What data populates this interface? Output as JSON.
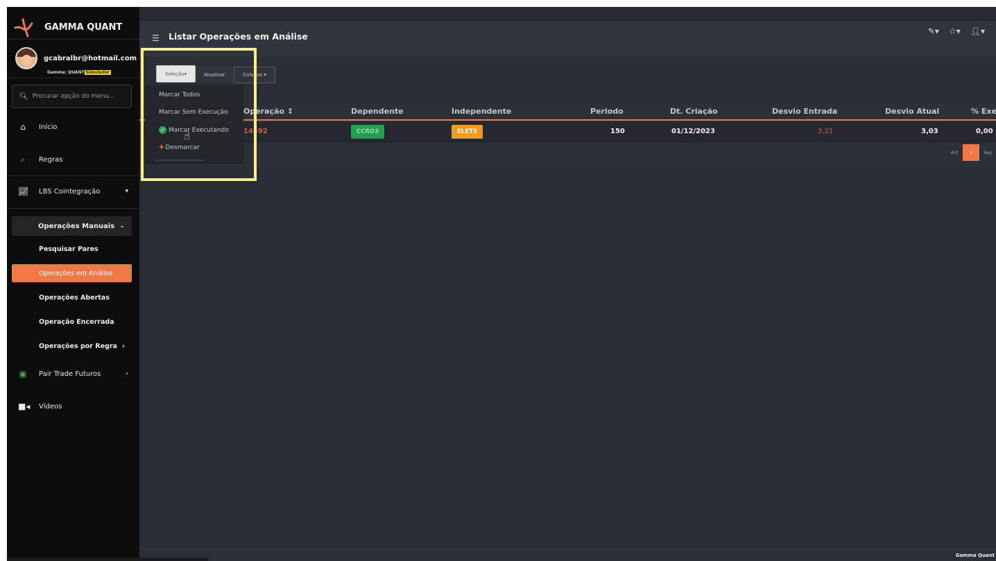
{
  "brand": {
    "name": "GAMMA QUANT"
  },
  "user": {
    "email": "gcabralbr@hotmail.com",
    "plan_prefix": "Gamma: QUANT",
    "plan_tag": "Simulador"
  },
  "search": {
    "placeholder": "Procurar opção do menu..."
  },
  "nav": {
    "inicio": "Início",
    "regras": "Regras",
    "lbs": "LBS Cointegração",
    "operacoes_manuais": "Operações Manuais",
    "subs": [
      "Pesquisar Pares",
      "Operações em Análise",
      "Operações Abertas",
      "Operação Encerrada",
      "Operações por Regra"
    ],
    "pair_trade": "Pair Trade Futuros",
    "videos": "Vídeos"
  },
  "header": {
    "title": "Listar Operações em Análise"
  },
  "toolbar": {
    "selecao": "Seleção",
    "atualizar": "Atualizar",
    "colunas": "Colunas"
  },
  "dropdown": [
    "Marcar Todos",
    "Marcar Sem Execução",
    "Marcar Executando",
    "Desmarcar"
  ],
  "table": {
    "headers": [
      "Operação",
      "Dependente",
      "Independente",
      "Periodo",
      "Dt. Criação",
      "Desvio Entrada",
      "Desvio Atual",
      "% Exec"
    ],
    "row": {
      "operacao": "14392",
      "dependente": "CCRO3",
      "independente": "ELET3",
      "periodo": "150",
      "dt_criacao": "01/12/2023",
      "desvio_entrada": "3,21",
      "desvio_atual": "3,03",
      "exec": "0,00"
    },
    "pager": {
      "prev": "Ant",
      "page": "1",
      "next": "Seg"
    }
  },
  "footer": {
    "text": "Gamma Quant"
  },
  "colors": {
    "accent": "#f07846",
    "dependente_badge": "#21a14f",
    "independente_badge": "#f39a1e",
    "highlight": "#f8f08a",
    "negative_value": "#e8543a"
  }
}
